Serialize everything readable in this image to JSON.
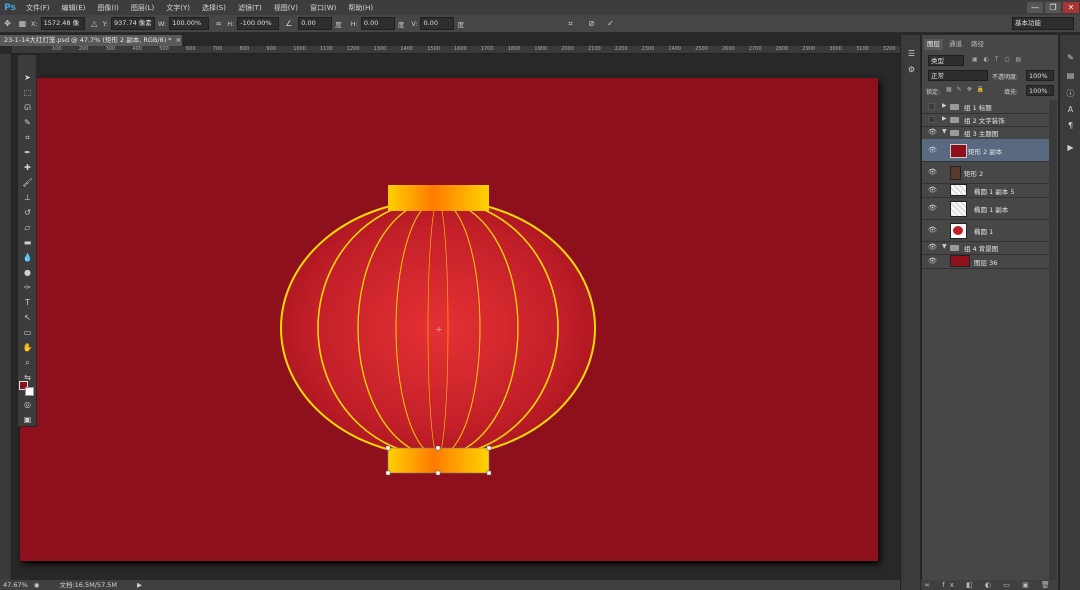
{
  "app": {
    "logo": "Ps"
  },
  "menu": [
    "文件(F)",
    "编辑(E)",
    "图像(I)",
    "图层(L)",
    "文字(Y)",
    "选择(S)",
    "滤镜(T)",
    "视图(V)",
    "窗口(W)",
    "帮助(H)"
  ],
  "window_controls": {
    "minimize": "—",
    "restore": "❐",
    "close": "✕"
  },
  "options": {
    "x_label": "X:",
    "x_value": "1572.48 像",
    "y_label": "Y:",
    "y_value": "937.74 像素",
    "w_label": "W:",
    "w_value": "100.00%",
    "h_label": "H:",
    "h_value": "-100.00%",
    "angle_value": "0.00",
    "angle_unit": "度",
    "h_skew_label": "H:",
    "h_skew_value": "0.00",
    "h_skew_unit": "度",
    "v_skew_label": "V:",
    "v_skew_value": "0.00",
    "v_skew_unit": "度",
    "workspace": "基本功能"
  },
  "document": {
    "tab_title": "23-1-14大红灯笼.psd @ 47.7% (矩形 2 副本, RGB/8) *",
    "tab_close": "×"
  },
  "ruler_top": [
    "100",
    "200",
    "300",
    "400",
    "500",
    "600",
    "700",
    "800",
    "900",
    "1000",
    "1100",
    "1200",
    "1300",
    "1400",
    "1500",
    "1600",
    "1700",
    "1800",
    "1900",
    "2000",
    "2100",
    "2200",
    "2300",
    "2400",
    "2500",
    "2600",
    "2700",
    "2800",
    "2900",
    "3000",
    "3100",
    "3200"
  ],
  "colors": {
    "canvas_bg": "#8e101c",
    "lantern_red": "#c42029",
    "lantern_gold": "#ffdc00",
    "lantern_orange": "#ff7a00",
    "foreground": "#8e101c",
    "background": "#ffffff"
  },
  "status": {
    "zoom": "47.67%",
    "doc_size": "文档:16.5M/57.5M",
    "arrow": "▶"
  },
  "layers_panel": {
    "tabs": [
      "图层",
      "通道",
      "路径"
    ],
    "filter_kind": "类型",
    "blend_mode": "正常",
    "opacity_label": "不透明度:",
    "opacity_value": "100%",
    "lock_label": "锁定:",
    "fill_label": "填充:",
    "fill_value": "100%",
    "layers": [
      {
        "name": "组 1 标题",
        "type": "group",
        "visible": false,
        "expanded": false
      },
      {
        "name": "组 2 文字装饰",
        "type": "group",
        "visible": false,
        "expanded": false
      },
      {
        "name": "组 3 主题图",
        "type": "group",
        "visible": true,
        "expanded": true
      },
      {
        "name": "矩形 2 副本",
        "type": "shape",
        "visible": true,
        "selected": true
      },
      {
        "name": "矩形 2",
        "type": "shape",
        "visible": true
      },
      {
        "name": "椭圆 1 副本 5",
        "type": "transparent",
        "visible": true
      },
      {
        "name": "椭圆 1 副本",
        "type": "transparent",
        "visible": true
      },
      {
        "name": "椭圆 1",
        "type": "ellipse",
        "visible": true
      },
      {
        "name": "组 4 背景图",
        "type": "group",
        "visible": true,
        "expanded": true
      },
      {
        "name": "图层 36",
        "type": "fill",
        "visible": true
      }
    ],
    "footer_icons": "∞ fx ◧ ◐ ▭ ▣ 🗑"
  }
}
